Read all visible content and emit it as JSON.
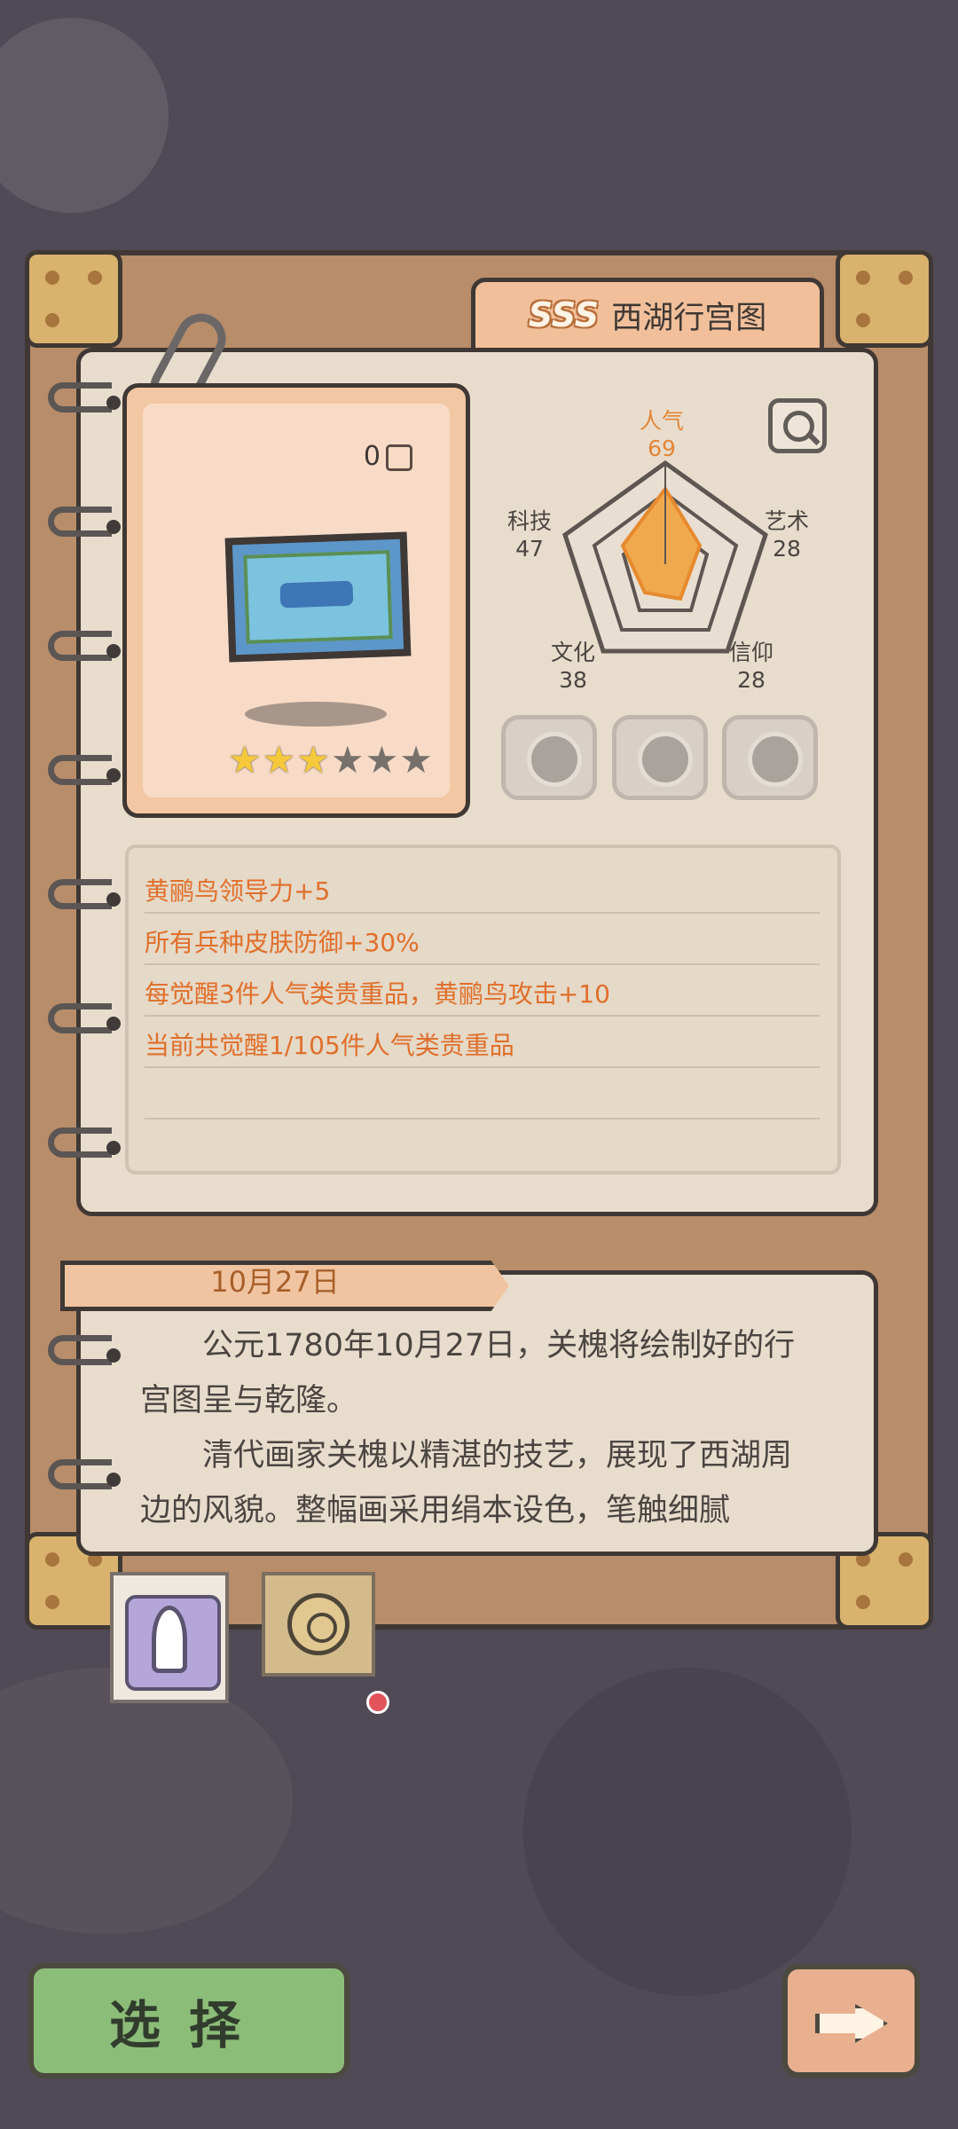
{
  "header": {
    "grade": "SSS",
    "title": "西湖行宫图"
  },
  "item": {
    "count": "0",
    "stars": {
      "filled": 3,
      "total": 6
    }
  },
  "stats": {
    "popularity": {
      "label": "人气",
      "value": "69"
    },
    "technology": {
      "label": "科技",
      "value": "47"
    },
    "art": {
      "label": "艺术",
      "value": "28"
    },
    "culture": {
      "label": "文化",
      "value": "38"
    },
    "faith": {
      "label": "信仰",
      "value": "28"
    }
  },
  "effects": [
    "黄鹂鸟领导力+5",
    "所有兵种皮肤防御+30%",
    "每觉醒3件人气类贵重品，黄鹂鸟攻击+10",
    "当前共觉醒1/105件人气类贵重品"
  ],
  "story": {
    "date": "10月27日",
    "paragraph1": "公元1780年10月27日，关槐将绘制好的行宫图呈与乾隆。",
    "paragraph2": "清代画家关槐以精湛的技艺，展现了西湖周边的风貌。整幅画采用绢本设色，笔触细腻"
  },
  "buttons": {
    "select": "选择"
  },
  "icons": {
    "search": "search-icon",
    "character": "portrait-icon",
    "sun": "sun-icon",
    "next": "right-arrow-icon"
  }
}
